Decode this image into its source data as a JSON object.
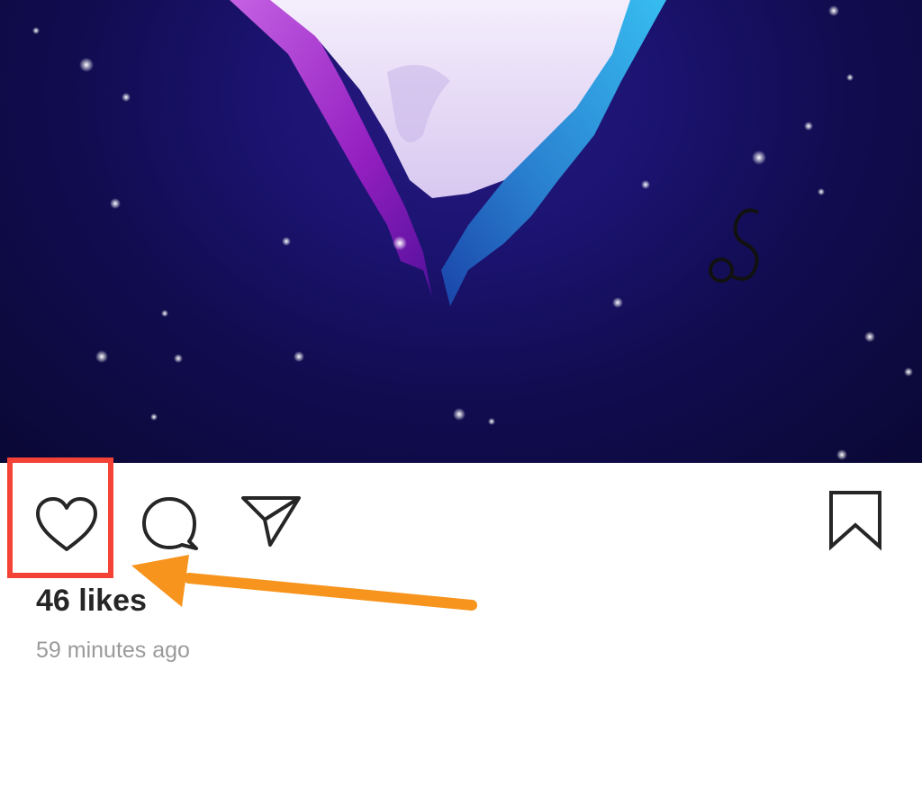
{
  "post": {
    "likes_text": "46 likes",
    "timestamp": "59 minutes ago"
  },
  "actions": {
    "like": "heart-icon",
    "comment": "comment-icon",
    "share": "share-icon",
    "save": "bookmark-icon"
  },
  "annotation": {
    "highlight_color": "#f44336",
    "arrow_color": "#f7941d"
  }
}
